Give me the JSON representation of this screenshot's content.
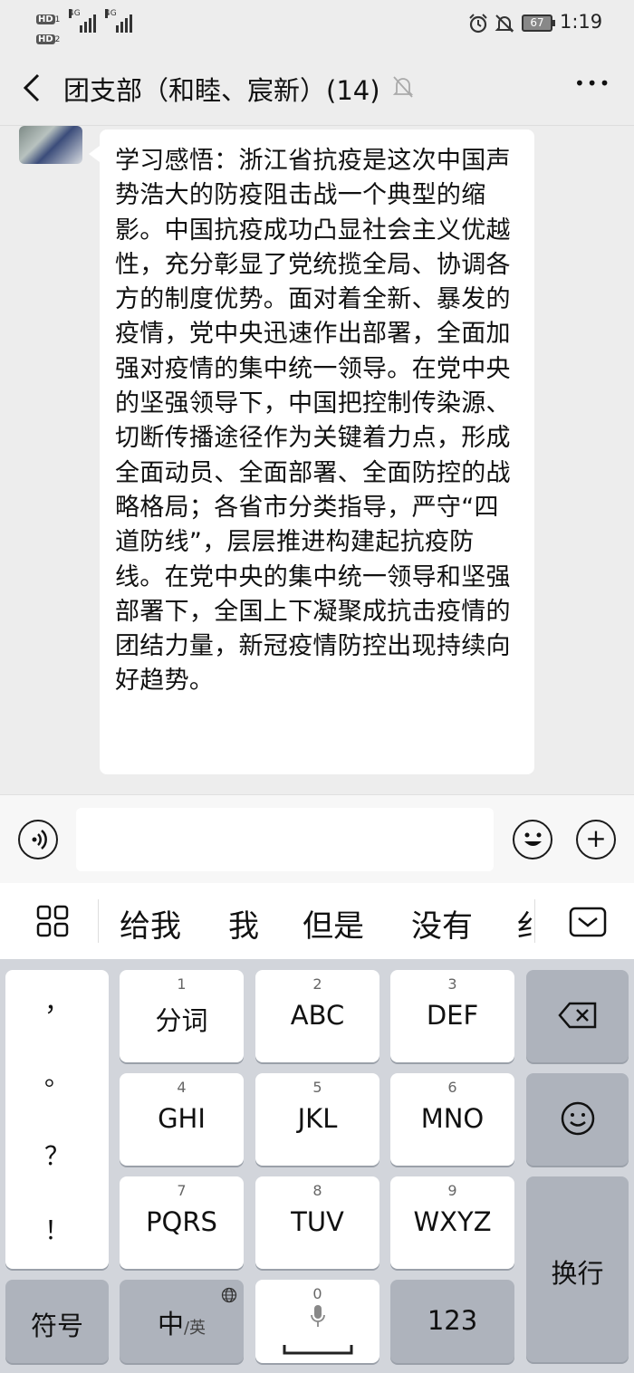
{
  "status_bar": {
    "hd1": "HD",
    "hd1_sub": "1",
    "hd2": "HD",
    "hd2_sub": "2",
    "net1": "4G",
    "net2": "4G",
    "battery": "67",
    "time": "1:19"
  },
  "header": {
    "title": "团支部（和睦、宸新）(14)",
    "more_label": "•••"
  },
  "message": {
    "text": "学习感悟：浙江省抗疫是这次中国声势浩大的防疫阻击战一个典型的缩影。中国抗疫成功凸显社会主义优越性，充分彰显了党统揽全局、协调各方的制度优势。面对着全新、暴发的疫情，党中央迅速作出部署，全面加强对疫情的集中统一领导。在党中央的坚强领导下，中国把控制传染源、切断传播途径作为关键着力点，形成全面动员、全面部署、全面防控的战略格局；各省市分类指导，严守“四道防线”，层层推进构建起抗疫防线。在党中央的集中统一领导和坚强部署下，全国上下凝聚成抗击疫情的团结力量，新冠疫情防控出现持续向好趋势。"
  },
  "input": {
    "value": "",
    "plus": "+"
  },
  "candidates": [
    "给我",
    "我",
    "但是",
    "没有",
    "纟"
  ],
  "keyboard": {
    "punct": [
      "，",
      "。",
      "？",
      "！"
    ],
    "keys": [
      {
        "num": "1",
        "label": "分词"
      },
      {
        "num": "2",
        "label": "ABC"
      },
      {
        "num": "3",
        "label": "DEF"
      },
      {
        "num": "4",
        "label": "GHI"
      },
      {
        "num": "5",
        "label": "JKL"
      },
      {
        "num": "6",
        "label": "MNO"
      },
      {
        "num": "7",
        "label": "PQRS"
      },
      {
        "num": "8",
        "label": "TUV"
      },
      {
        "num": "9",
        "label": "WXYZ"
      }
    ],
    "symbols": "符号",
    "lang_main": "中",
    "lang_sub": "/英",
    "space_num": "0",
    "num_key": "123",
    "enter": "换行"
  }
}
